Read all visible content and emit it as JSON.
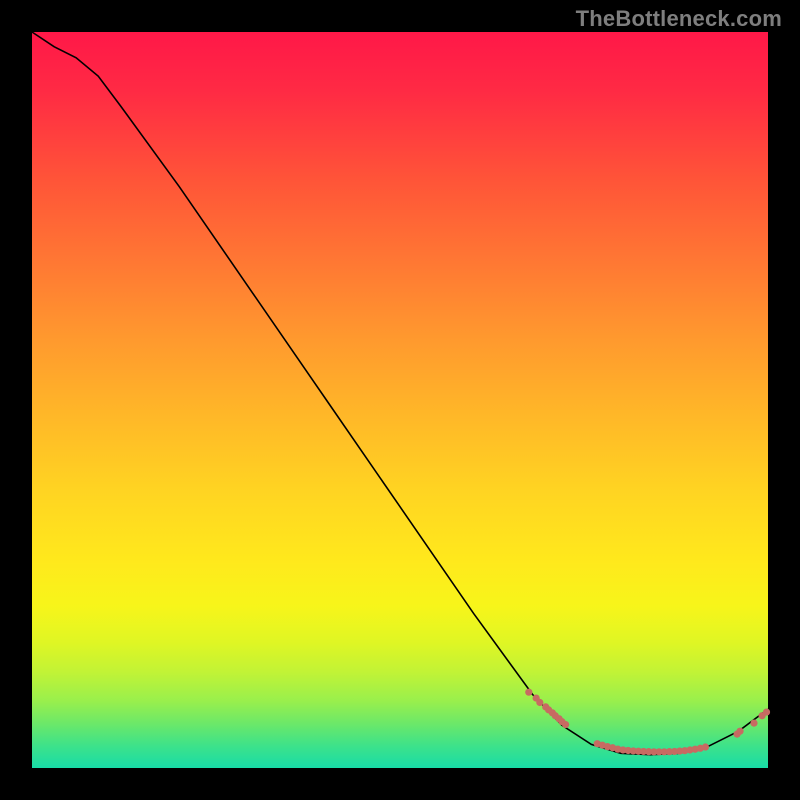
{
  "watermark": "TheBottleneck.com",
  "chart_data": {
    "type": "line",
    "title": "",
    "xlabel": "",
    "ylabel": "",
    "xlim": [
      0,
      100
    ],
    "ylim": [
      0,
      100
    ],
    "curve": [
      {
        "x": 0,
        "y": 100
      },
      {
        "x": 3,
        "y": 98
      },
      {
        "x": 6,
        "y": 96.5
      },
      {
        "x": 9,
        "y": 94
      },
      {
        "x": 12,
        "y": 90
      },
      {
        "x": 20,
        "y": 79
      },
      {
        "x": 30,
        "y": 64.5
      },
      {
        "x": 40,
        "y": 50
      },
      {
        "x": 50,
        "y": 35.5
      },
      {
        "x": 60,
        "y": 21
      },
      {
        "x": 68,
        "y": 10
      },
      {
        "x": 72,
        "y": 5.8
      },
      {
        "x": 76,
        "y": 3.2
      },
      {
        "x": 80,
        "y": 2.0
      },
      {
        "x": 84,
        "y": 1.8
      },
      {
        "x": 88,
        "y": 2.0
      },
      {
        "x": 92,
        "y": 3.0
      },
      {
        "x": 96,
        "y": 5.0
      },
      {
        "x": 100,
        "y": 8.0
      }
    ],
    "series": [
      {
        "name": "upper-cluster",
        "points": [
          {
            "x": 67.5,
            "y": 10.3
          },
          {
            "x": 68.5,
            "y": 9.5
          },
          {
            "x": 69.0,
            "y": 8.9
          },
          {
            "x": 69.8,
            "y": 8.3
          },
          {
            "x": 70.2,
            "y": 7.9
          },
          {
            "x": 70.7,
            "y": 7.5
          },
          {
            "x": 71.1,
            "y": 7.1
          },
          {
            "x": 71.6,
            "y": 6.7
          },
          {
            "x": 72.0,
            "y": 6.3
          },
          {
            "x": 72.5,
            "y": 5.9
          }
        ]
      },
      {
        "name": "flat-cluster",
        "points": [
          {
            "x": 76.8,
            "y": 3.3
          },
          {
            "x": 77.5,
            "y": 3.1
          },
          {
            "x": 78.2,
            "y": 2.9
          },
          {
            "x": 78.9,
            "y": 2.75
          },
          {
            "x": 79.6,
            "y": 2.56
          },
          {
            "x": 80.3,
            "y": 2.45
          },
          {
            "x": 81.0,
            "y": 2.38
          },
          {
            "x": 81.7,
            "y": 2.32
          },
          {
            "x": 82.4,
            "y": 2.28
          },
          {
            "x": 83.1,
            "y": 2.25
          },
          {
            "x": 83.8,
            "y": 2.22
          },
          {
            "x": 84.5,
            "y": 2.2
          },
          {
            "x": 85.2,
            "y": 2.2
          },
          {
            "x": 85.9,
            "y": 2.2
          },
          {
            "x": 86.6,
            "y": 2.22
          },
          {
            "x": 87.3,
            "y": 2.25
          },
          {
            "x": 88.0,
            "y": 2.3
          },
          {
            "x": 88.7,
            "y": 2.35
          },
          {
            "x": 89.4,
            "y": 2.45
          },
          {
            "x": 90.1,
            "y": 2.55
          },
          {
            "x": 90.8,
            "y": 2.68
          },
          {
            "x": 91.5,
            "y": 2.85
          }
        ]
      },
      {
        "name": "tail-cluster",
        "points": [
          {
            "x": 95.8,
            "y": 4.6
          },
          {
            "x": 96.2,
            "y": 5.0
          },
          {
            "x": 98.1,
            "y": 6.1
          },
          {
            "x": 99.2,
            "y": 7.1
          },
          {
            "x": 99.8,
            "y": 7.6
          }
        ]
      }
    ],
    "annotations": [
      {
        "text": "",
        "x": 79,
        "y": 3.6
      }
    ]
  }
}
